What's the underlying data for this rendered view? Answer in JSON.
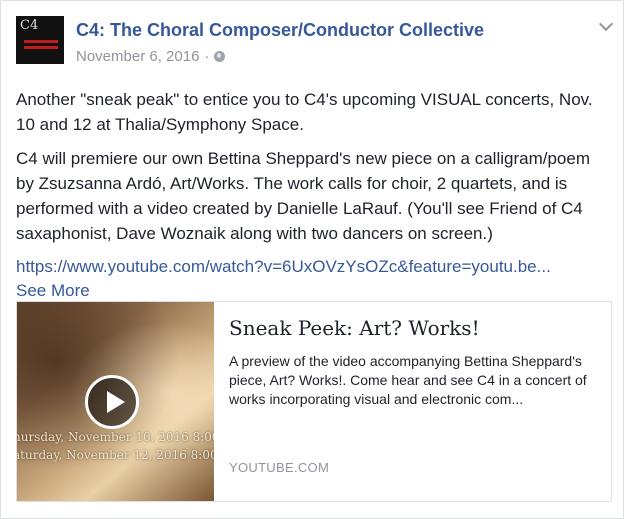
{
  "post": {
    "author": "C4: The Choral Composer/Conductor Collective",
    "date": "November 6, 2016",
    "privacy_separator": "·",
    "privacy_icon": "globe-icon",
    "paragraph1": "Another \"sneak peak\" to entice you to C4's upcoming VISUAL concerts, Nov. 10 and 12 at Thalia/Symphony Space.",
    "paragraph2": "C4 will premiere our own Bettina Sheppard's new piece on a calligram/poem by Zsuzsanna Ardó, Art/Works. The work calls for choir, 2 quartets, and is performed with a video created by Danielle LaRauf. (You'll see Friend of C4 saxaphonist, Dave Woznaik along with two dancers on screen.)",
    "link": "https://www.youtube.com/watch?v=6UxOVzYsOZc&feature=youtu.be...",
    "see_more": "See More"
  },
  "card": {
    "title": "Sneak Peek: Art? Works!",
    "description": "A preview of the video accompanying Bettina Sheppard's piece, Art? Works!. Come hear and see C4 in a concert of works incorporating visual and electronic com...",
    "domain": "YOUTUBE.COM",
    "thumb_caption1": "hursday, November 10, 2016 8:00 p",
    "thumb_caption2": "aturday, November 12, 2016 8:00 p"
  },
  "colors": {
    "link": "#365899",
    "meta": "#90949c",
    "text": "#1d2129"
  }
}
